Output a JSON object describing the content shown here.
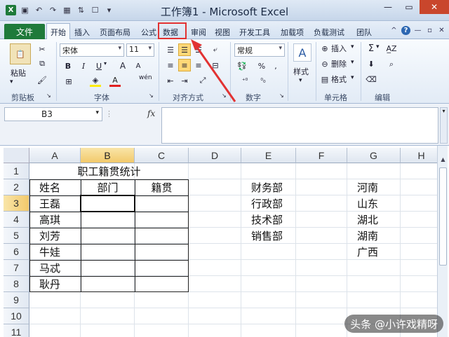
{
  "window": {
    "title": "工作簿1 - Microsoft Excel",
    "app_icon": "X"
  },
  "tabs": {
    "file": "文件",
    "items": [
      "开始",
      "插入",
      "页面布局",
      "公式",
      "数据",
      "审阅",
      "视图",
      "开发工具",
      "加载项",
      "负载测试",
      "团队"
    ],
    "active": "开始",
    "highlighted": "数据"
  },
  "ribbon": {
    "clipboard": {
      "paste": "粘贴",
      "label": "剪贴板"
    },
    "font": {
      "name": "宋体",
      "size": "11",
      "bold": "B",
      "italic": "I",
      "underline": "U",
      "grow": "A",
      "shrink": "A",
      "label": "字体",
      "wen": "wén"
    },
    "alignment": {
      "label": "对齐方式"
    },
    "number": {
      "format": "常规",
      "percent": "%",
      "label": "数字"
    },
    "styles": {
      "label": "样式"
    },
    "cells": {
      "insert": "插入",
      "delete": "删除",
      "format": "格式",
      "label": "单元格"
    },
    "editing": {
      "sigma": "Σ",
      "label": "编辑"
    }
  },
  "formula_bar": {
    "name_box": "B3",
    "fx": "fx"
  },
  "columns": [
    "A",
    "B",
    "C",
    "D",
    "E",
    "F",
    "G",
    "H"
  ],
  "rows": [
    "1",
    "2",
    "3",
    "4",
    "5",
    "6",
    "7",
    "8",
    "9",
    "10",
    "11"
  ],
  "cells": {
    "title": "职工籍贯统计",
    "header_name": "姓名",
    "header_dept": "部门",
    "header_origin": "籍贯",
    "names": [
      "王磊",
      "高琪",
      "刘芳",
      "牛娃",
      "马忒",
      "耿丹"
    ],
    "departments": [
      "财务部",
      "行政部",
      "技术部",
      "销售部"
    ],
    "provinces": [
      "河南",
      "山东",
      "湖北",
      "湖南",
      "广西"
    ]
  },
  "watermark": "头条 @小许戏精呀",
  "colors": {
    "file_tab": "#1f7a3a",
    "highlight": "#e23232",
    "selected_header": "#f2c96b"
  }
}
